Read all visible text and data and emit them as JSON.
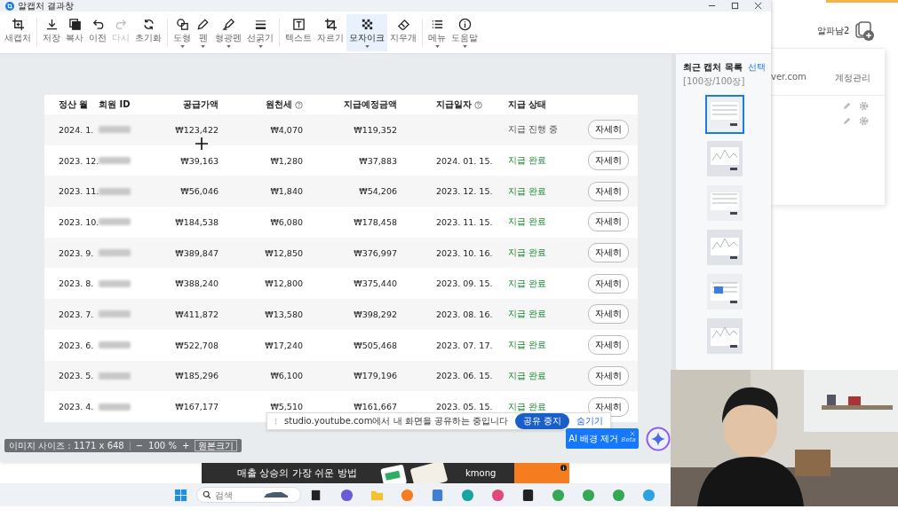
{
  "window": {
    "title": "알캡처 결과창"
  },
  "toolbar": {
    "groups": [
      [
        {
          "label": "새캡처",
          "disabled": false,
          "selected": false,
          "dropdown": false
        }
      ],
      [
        {
          "label": "저장",
          "disabled": false,
          "selected": false,
          "dropdown": false
        },
        {
          "label": "복사",
          "disabled": false,
          "selected": false,
          "dropdown": false
        },
        {
          "label": "이전",
          "disabled": false,
          "selected": false,
          "dropdown": false
        },
        {
          "label": "다시",
          "disabled": true,
          "selected": false,
          "dropdown": false
        },
        {
          "label": "초기화",
          "disabled": false,
          "selected": false,
          "dropdown": false
        }
      ],
      [
        {
          "label": "도형",
          "disabled": false,
          "selected": false,
          "dropdown": true
        },
        {
          "label": "펜",
          "disabled": false,
          "selected": false,
          "dropdown": true
        },
        {
          "label": "형광펜",
          "disabled": false,
          "selected": false,
          "dropdown": true
        },
        {
          "label": "선굵기",
          "disabled": false,
          "selected": false,
          "dropdown": true
        }
      ],
      [
        {
          "label": "텍스트",
          "disabled": false,
          "selected": false,
          "dropdown": false
        },
        {
          "label": "자르기",
          "disabled": false,
          "selected": false,
          "dropdown": false
        },
        {
          "label": "모자이크",
          "disabled": false,
          "selected": true,
          "dropdown": true
        },
        {
          "label": "지우개",
          "disabled": false,
          "selected": false,
          "dropdown": false
        }
      ],
      [
        {
          "label": "메뉴",
          "disabled": false,
          "selected": false,
          "dropdown": true
        },
        {
          "label": "도움말",
          "disabled": false,
          "selected": false,
          "dropdown": true
        }
      ]
    ]
  },
  "table": {
    "columns": [
      {
        "label": "정산 월",
        "help": false
      },
      {
        "label": "회원 ID",
        "help": false
      },
      {
        "label": "공급가액",
        "help": false
      },
      {
        "label": "원천세",
        "help": true
      },
      {
        "label": "지급예정금액",
        "help": false
      },
      {
        "label": "지급일자",
        "help": true
      },
      {
        "label": "지급 상태",
        "help": false
      }
    ],
    "rows": [
      {
        "month": "2024. 1.",
        "supply": "₩123,422",
        "tax": "₩4,070",
        "payout": "₩119,352",
        "status": "지급 진행 중",
        "completed": false,
        "action": "자세히"
      },
      {
        "month": "2023. 12.",
        "supply": "₩39,163",
        "tax": "₩1,280",
        "payout": "₩37,883",
        "pay_date": "2024. 01. 15.",
        "status": "지급 완료",
        "completed": true,
        "action": "자세히"
      },
      {
        "month": "2023. 11.",
        "supply": "₩56,046",
        "tax": "₩1,840",
        "payout": "₩54,206",
        "pay_date": "2023. 12. 15.",
        "status": "지급 완료",
        "completed": true,
        "action": "자세히"
      },
      {
        "month": "2023. 10.",
        "supply": "₩184,538",
        "tax": "₩6,080",
        "payout": "₩178,458",
        "pay_date": "2023. 11. 15.",
        "status": "지급 완료",
        "completed": true,
        "action": "자세히"
      },
      {
        "month": "2023. 9.",
        "supply": "₩389,847",
        "tax": "₩12,850",
        "payout": "₩376,997",
        "pay_date": "2023. 10. 16.",
        "status": "지급 완료",
        "completed": true,
        "action": "자세히"
      },
      {
        "month": "2023. 8.",
        "supply": "₩388,240",
        "tax": "₩12,800",
        "payout": "₩375,440",
        "pay_date": "2023. 09. 15.",
        "status": "지급 완료",
        "completed": true,
        "action": "자세히"
      },
      {
        "month": "2023. 7.",
        "supply": "₩411,872",
        "tax": "₩13,580",
        "payout": "₩398,292",
        "pay_date": "2023. 08. 16.",
        "status": "지급 완료",
        "completed": true,
        "action": "자세히"
      },
      {
        "month": "2023. 6.",
        "supply": "₩522,708",
        "tax": "₩17,240",
        "payout": "₩505,468",
        "pay_date": "2023. 07. 17.",
        "status": "지급 완료",
        "completed": true,
        "action": "자세히"
      },
      {
        "month": "2023. 5.",
        "supply": "₩185,296",
        "tax": "₩6,100",
        "payout": "₩179,196",
        "pay_date": "2023. 06. 15.",
        "status": "지급 완료",
        "completed": true,
        "action": "자세히"
      },
      {
        "month": "2023. 4.",
        "supply": "₩167,177",
        "tax": "₩5,510",
        "payout": "₩161,667",
        "pay_date": "2023. 05. 15.",
        "status": "지급 완료",
        "completed": true,
        "action": "자세히"
      }
    ]
  },
  "image_size": {
    "label": "이미지 사이즈 : 1171 x 648",
    "zoom_out": "−",
    "zoom": "100 %",
    "zoom_in": "+",
    "original": "원본크기"
  },
  "recent": {
    "title": "최근 캡처 목록",
    "select": "선택",
    "count": "[100장/100장]",
    "thumbnails": [
      {
        "selected": true
      },
      {
        "selected": false
      },
      {
        "selected": false
      },
      {
        "selected": false
      },
      {
        "selected": false
      },
      {
        "selected": false
      }
    ]
  },
  "ai_button": {
    "label": "AI 배경 제거",
    "badge": "Beta"
  },
  "share_bar": {
    "message": "studio.youtube.com에서 내 화면을 공유하는 중입니다",
    "stop": "공유 중지",
    "hide": "숨기기"
  },
  "browser": {
    "user": "알파남2",
    "email": "ver.com",
    "manage": "계정관리"
  },
  "ad": {
    "headline": "매출 상승의 가장 쉬운 방법",
    "brand": "kmong"
  },
  "taskbar": {
    "search": {
      "placeholder": "검색"
    }
  }
}
